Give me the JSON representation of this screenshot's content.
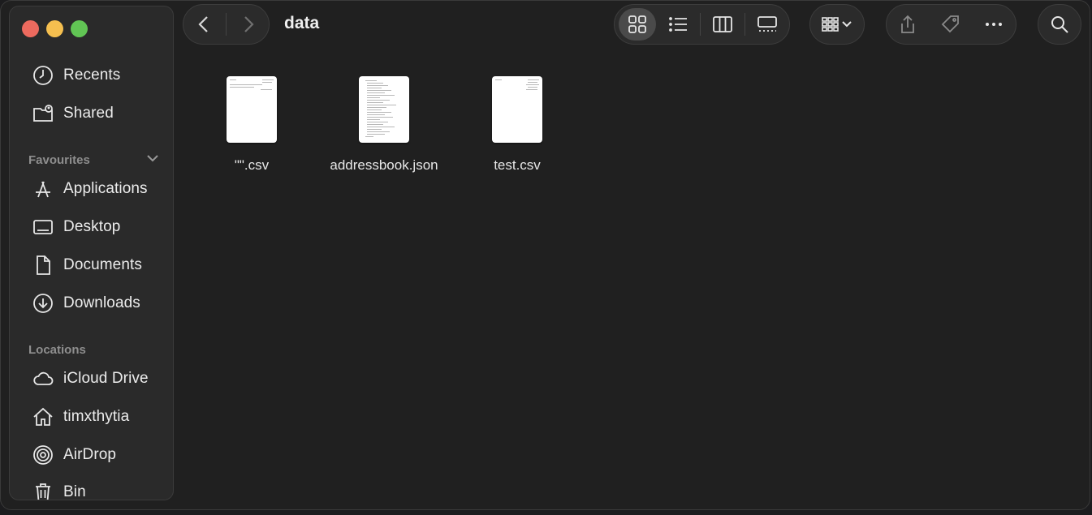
{
  "window": {
    "title": "data"
  },
  "sidebar": {
    "items_top": [
      {
        "label": "Recents",
        "icon": "clock-icon"
      },
      {
        "label": "Shared",
        "icon": "shared-folder-icon"
      }
    ],
    "favourites_heading": "Favourites",
    "favourites": [
      {
        "label": "Applications",
        "icon": "applications-icon"
      },
      {
        "label": "Desktop",
        "icon": "desktop-icon"
      },
      {
        "label": "Documents",
        "icon": "document-icon"
      },
      {
        "label": "Downloads",
        "icon": "download-icon"
      }
    ],
    "locations_heading": "Locations",
    "locations": [
      {
        "label": "iCloud Drive",
        "icon": "cloud-icon"
      },
      {
        "label": "timxthytia",
        "icon": "home-icon"
      },
      {
        "label": "AirDrop",
        "icon": "airdrop-icon"
      },
      {
        "label": "Bin",
        "icon": "trash-icon"
      }
    ]
  },
  "toolbar": {
    "view_modes": [
      "icon-view",
      "list-view",
      "column-view",
      "gallery-view"
    ],
    "selected_view": "icon-view"
  },
  "files": [
    {
      "name": "\"\".csv",
      "kind": "csv"
    },
    {
      "name": "addressbook.json",
      "kind": "json"
    },
    {
      "name": "test.csv",
      "kind": "csv"
    }
  ],
  "colors": {
    "window_bg": "#202020",
    "sidebar_bg": "#2a2a2a",
    "close": "#ed6a5e",
    "minimize": "#f5bf4f",
    "zoom": "#61c554"
  }
}
